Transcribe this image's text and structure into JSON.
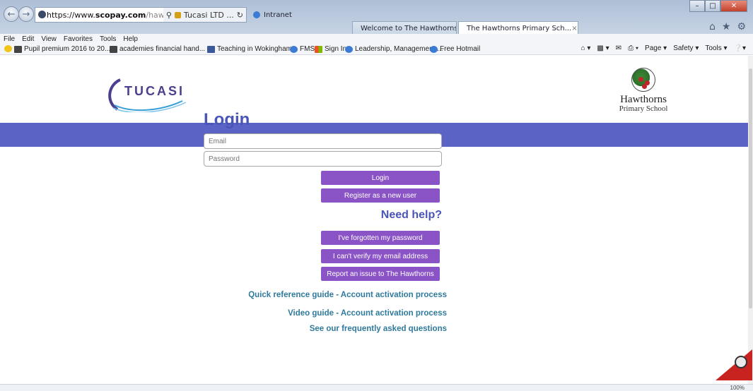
{
  "browser": {
    "address": {
      "protocol": "https://www.",
      "domain": "scopay.com",
      "path": "/hawthorns?",
      "site_tab": "Tucasi LTD ..."
    },
    "tabs": [
      {
        "label": "Intranet"
      },
      {
        "label": "Welcome to The Hawthorns Pri..."
      },
      {
        "label": "The Hawthorns Primary Sch...",
        "close": "×"
      }
    ],
    "menu": [
      "File",
      "Edit",
      "View",
      "Favorites",
      "Tools",
      "Help"
    ],
    "favorites": [
      {
        "label": "Pupil premium 2016 to 20...",
        "icon": "bookmark-icon"
      },
      {
        "label": "academies financial hand...",
        "icon": "bookmark-icon"
      },
      {
        "label": "Teaching in Wokingham",
        "icon": "facebook-icon"
      },
      {
        "label": "FMS",
        "icon": "ie-icon"
      },
      {
        "label": "Sign In",
        "icon": "windows-icon"
      },
      {
        "label": "Leadership, Management ...",
        "icon": "ie-icon"
      },
      {
        "label": "Free Hotmail",
        "icon": "ie-icon"
      }
    ],
    "command_bar": {
      "page": "Page ▾",
      "safety": "Safety ▾",
      "tools": "Tools ▾"
    },
    "zoom": "100%"
  },
  "page": {
    "brand": "TUCASI",
    "school": {
      "line1": "Hawthorns",
      "line2": "Primary School"
    },
    "login_title": "Login",
    "email_placeholder": "Email",
    "password_placeholder": "Password",
    "login_button": "Login",
    "register_button": "Register as a new user",
    "help_title": "Need help?",
    "forgot_button": "I've forgotten my password",
    "verify_button": "I can't verify my email address",
    "report_button": "Report an issue to The Hawthorns",
    "links": {
      "quick_guide": "Quick reference guide - Account activation process",
      "video_guide": "Video guide - Account activation process",
      "faq": "See our frequently asked questions"
    }
  },
  "colors": {
    "banner": "#5b64c4",
    "button": "#8a53c6",
    "heading": "#4a55b8",
    "link": "#2f7a9c"
  }
}
